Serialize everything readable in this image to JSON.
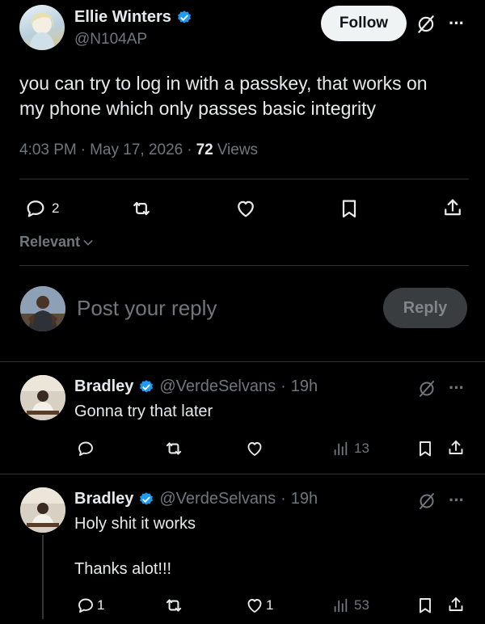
{
  "post": {
    "author_name": "Ellie Winters",
    "author_handle": "@N104AP",
    "follow_label": "Follow",
    "more_label": "···",
    "text_line1": "you can try to log in with a passkey, that works on",
    "text_line2": "my phone which only passes basic integrity",
    "time": "4:03 PM",
    "sep1": "·",
    "date": "May 17, 2026",
    "sep2": "·",
    "views_count": "72",
    "views_label": "Views",
    "reply_count": "2"
  },
  "sort": {
    "label": "Relevant"
  },
  "composer": {
    "placeholder": "Post your reply",
    "reply_button": "Reply"
  },
  "replies": [
    {
      "name": "Bradley",
      "handle": "@VerdeSelvans",
      "sep": "·",
      "time": "19h",
      "text_line1": "Gonna try that later",
      "text_line2": "",
      "reply_count": "",
      "like_count": "",
      "views": "13",
      "more_label": "···"
    },
    {
      "name": "Bradley",
      "handle": "@VerdeSelvans",
      "sep": "·",
      "time": "19h",
      "text_line1": "Holy shit it works",
      "text_line2": "Thanks alot!!!",
      "reply_count": "1",
      "like_count": "1",
      "views": "53",
      "more_label": "···"
    }
  ],
  "colors": {
    "background": "#000000",
    "text": "#e7e9ea",
    "muted": "#71767b",
    "verified": "#1d9bf0",
    "divider": "#2f3336"
  }
}
